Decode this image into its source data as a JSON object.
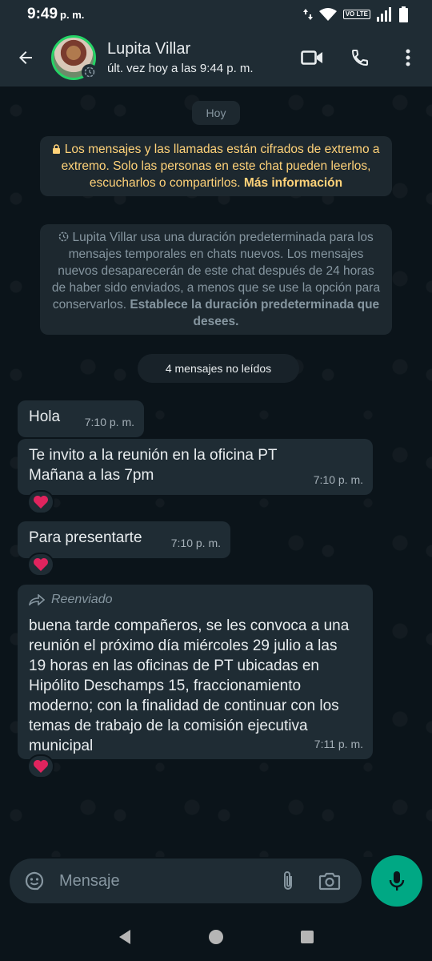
{
  "status_bar": {
    "time": "9:49",
    "ampm": "p. m.",
    "volte_label": "VO LTE"
  },
  "header": {
    "contact_name": "Lupita Villar",
    "last_seen": "últ. vez hoy a las 9:44 p. m."
  },
  "chat": {
    "date_pill": "Hoy",
    "encryption_notice": {
      "text": "Los mensajes y las llamadas están cifrados de extremo a extremo. Solo las personas en este chat pueden leerlos, escucharlos o compartirlos.",
      "link": "Más información"
    },
    "temporary_notice": {
      "text": "Lupita Villar usa una duración predeterminada para los mensajes temporales en chats nuevos. Los mensajes nuevos desaparecerán de este chat después de 24 horas de haber sido enviados, a menos que se use la opción para conservarlos.",
      "link": "Establece la duración predeterminada que desees."
    },
    "unread_banner": "4 mensajes no leídos",
    "messages": [
      {
        "text": "Hola",
        "time": "7:10 p. m."
      },
      {
        "text": "Te invito a la reunión en la oficina PT Mañana a las 7pm",
        "time": "7:10 p. m.",
        "reaction": "heart"
      },
      {
        "text": "Para presentarte",
        "time": "7:10 p. m.",
        "reaction": "heart"
      },
      {
        "forwarded_label": "Reenviado",
        "text": "buena tarde compañeros, se les convoca a una reunión el próximo día miércoles 29 julio a las 19 horas en las oficinas de PT ubicadas en Hipólito Deschamps 15, fraccionamiento moderno; con la finalidad de continuar con los temas de trabajo de la comisión ejecutiva municipal",
        "time": "7:11 p. m.",
        "reaction": "heart"
      }
    ]
  },
  "composer": {
    "placeholder": "Mensaje"
  },
  "colors": {
    "accent_green": "#00a884",
    "bubble_bg": "#1f2c34",
    "encryption_text": "#ffd279"
  }
}
